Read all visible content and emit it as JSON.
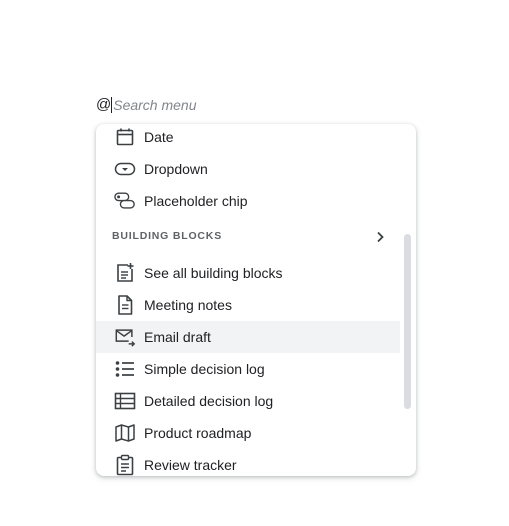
{
  "search": {
    "prefix": "@",
    "placeholder": "Search menu",
    "value": ""
  },
  "menu": {
    "top_items": [
      {
        "label": "Date",
        "icon": "calendar-icon"
      },
      {
        "label": "Dropdown",
        "icon": "dropdown-chip-icon"
      },
      {
        "label": "Placeholder chip",
        "icon": "placeholder-chip-icon"
      }
    ],
    "section": {
      "title": "BUILDING BLOCKS",
      "chevron_icon": "chevron-right-icon"
    },
    "building_blocks": [
      {
        "label": "See all building blocks",
        "icon": "note-add-icon"
      },
      {
        "label": "Meeting notes",
        "icon": "document-icon"
      },
      {
        "label": "Email draft",
        "icon": "email-forward-icon",
        "highlighted": true
      },
      {
        "label": "Simple decision log",
        "icon": "bulleted-list-icon"
      },
      {
        "label": "Detailed decision log",
        "icon": "table-icon"
      },
      {
        "label": "Product roadmap",
        "icon": "map-icon"
      },
      {
        "label": "Review tracker",
        "icon": "clipboard-icon"
      }
    ]
  },
  "colors": {
    "text": "#202124",
    "muted": "#5f6368",
    "placeholder": "#80868b",
    "highlight": "#f1f3f4",
    "scrollbar": "#dadce0"
  }
}
